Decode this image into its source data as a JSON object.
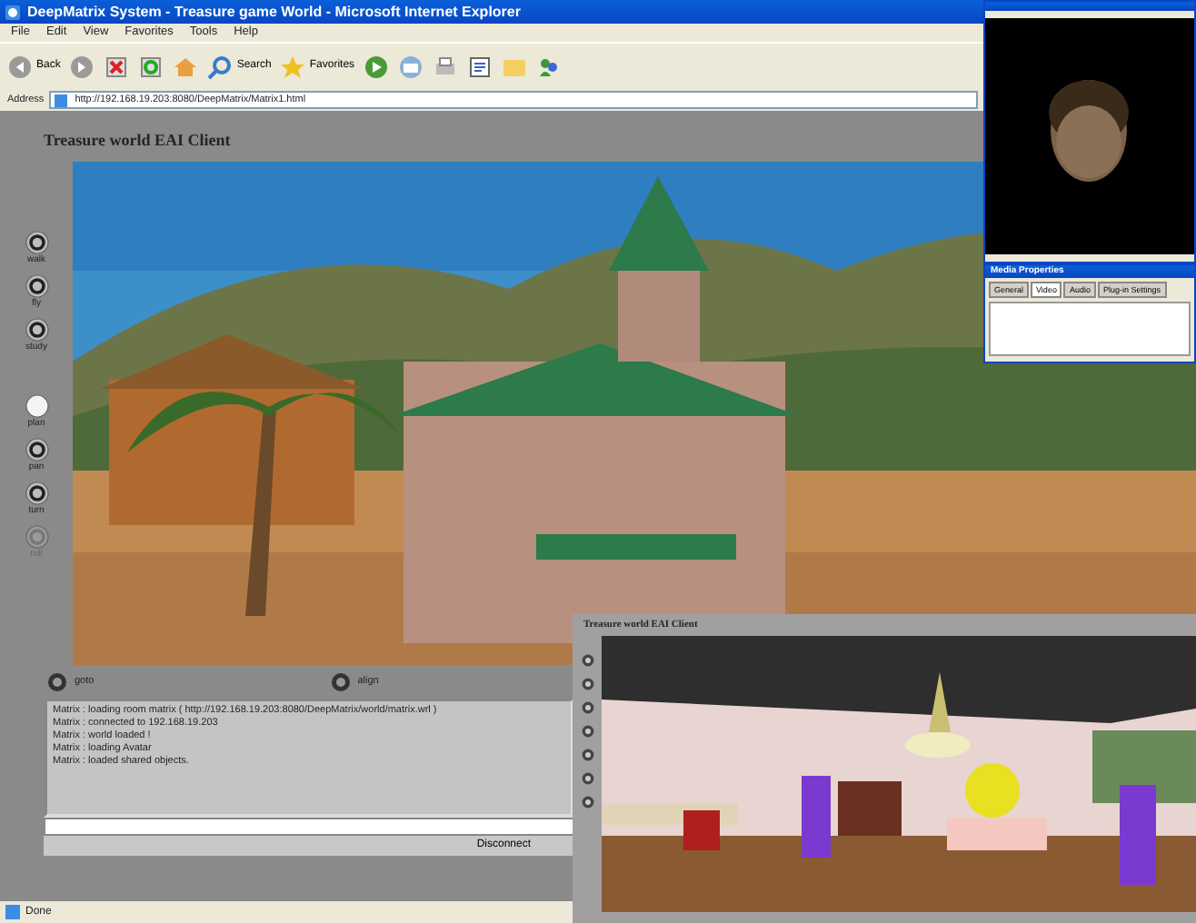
{
  "main_window": {
    "title": "DeepMatrix System - Treasure game World - Microsoft Internet Explorer",
    "menu": [
      "File",
      "Edit",
      "View",
      "Favorites",
      "Tools",
      "Help"
    ],
    "toolbar": [
      {
        "kind": "back",
        "label": "Back"
      },
      {
        "kind": "forward"
      },
      {
        "kind": "stop"
      },
      {
        "kind": "refresh"
      },
      {
        "kind": "home"
      },
      {
        "kind": "search",
        "label": "Search"
      },
      {
        "kind": "favorites",
        "label": "Favorites"
      },
      {
        "kind": "media"
      },
      {
        "kind": "mail"
      },
      {
        "kind": "print"
      },
      {
        "kind": "edit"
      },
      {
        "kind": "folder"
      },
      {
        "kind": "messenger"
      }
    ],
    "address_label": "Address",
    "address": "http://192.168.19.203:8080/DeepMatrix/Matrix1.html",
    "page_title": "Treasure world EAI Client",
    "nav_buttons": [
      {
        "label": "walk",
        "selected": false,
        "disabled": false
      },
      {
        "label": "fly",
        "selected": false,
        "disabled": false
      },
      {
        "label": "study",
        "selected": false,
        "disabled": false
      },
      {
        "label": "plan",
        "selected": true,
        "disabled": false
      },
      {
        "label": "pan",
        "selected": false,
        "disabled": false
      },
      {
        "label": "turn",
        "selected": false,
        "disabled": false
      },
      {
        "label": "roll",
        "selected": false,
        "disabled": true
      }
    ],
    "actions": [
      "goto",
      "align"
    ],
    "log": [
      "Matrix : loading room matrix ( http://192.168.19.203:8080/DeepMatrix/world/matrix.wrl )",
      "Matrix : connected to 192.168.19.203",
      "Matrix : world loaded !",
      "Matrix : loading Avatar",
      "Matrix : loaded shared objects."
    ],
    "disconnect": "Disconnect",
    "status": "Done"
  },
  "properties_window": {
    "title": "Media Properties",
    "tabs": [
      {
        "label": "General",
        "selected": false
      },
      {
        "label": "Video",
        "selected": true
      },
      {
        "label": "Audio",
        "selected": false
      },
      {
        "label": "Plug-in Settings",
        "selected": false
      }
    ]
  },
  "client_window": {
    "title": "Treasure world EAI Client"
  }
}
